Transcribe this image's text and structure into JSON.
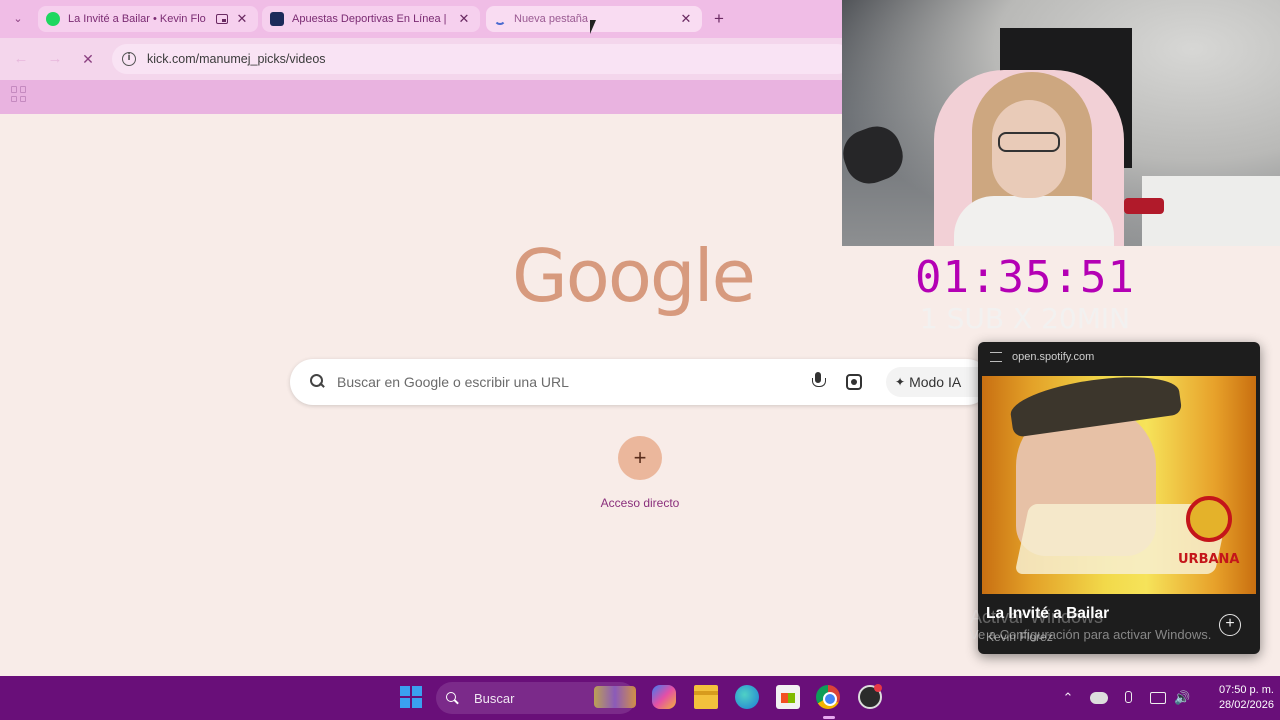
{
  "browser": {
    "tabs": [
      {
        "title": "La Invité a Bailar • Kevin Flo",
        "favicon": "spotify-icon",
        "favicon_color": "#1ed760",
        "has_pip": true
      },
      {
        "title": "Apuestas Deportivas En Línea |",
        "favicon": "bet-site-icon",
        "favicon_color": "#1c2a5a",
        "has_pip": false
      },
      {
        "title": "Nueva pestaña",
        "favicon": "loading-spinner",
        "loading": true
      }
    ],
    "url": "kick.com/manumej_picks/videos"
  },
  "newtab": {
    "logo": "Google",
    "search_placeholder": "Buscar en Google o escribir una URL",
    "ai_mode_label": "Modo IA",
    "shortcut_add_label": "Acceso directo"
  },
  "stream_overlay": {
    "timer": "01:35:51",
    "sub_rule": "1 SUB X 20MIN",
    "timer_color": "#b400b4"
  },
  "media_popup": {
    "source": "open.spotify.com",
    "track_title": "La Invité a Bailar",
    "artist": "Kevin Florez",
    "album_text": "URBANA"
  },
  "windows_activation": {
    "line1": "Activar Windows",
    "line2": "Ve a Configuración para activar Windows."
  },
  "taskbar": {
    "search_label": "Buscar",
    "time": "07:50 p. m.",
    "date": "28/02/2026",
    "accent": "#690f79"
  }
}
